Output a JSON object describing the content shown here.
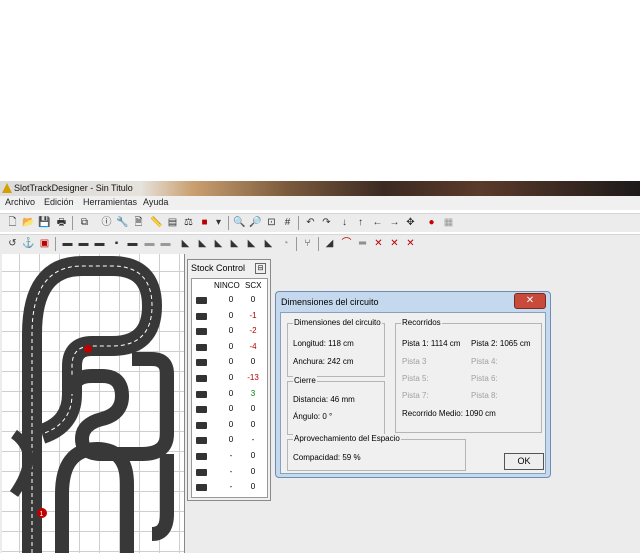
{
  "app": {
    "title": "SlotTrackDesigner - Sin Titulo"
  },
  "menu": [
    "Archivo",
    "Edición",
    "Herramientas",
    "Ayuda"
  ],
  "stock": {
    "title": "Stock Control",
    "close": "⊟",
    "col_ninco": "NINCO",
    "col_scx": "SCX",
    "rows": [
      {
        "icon": "straight-piece-icon",
        "ninco": "0",
        "scx": "0",
        "scx_color": "#000000"
      },
      {
        "icon": "straight-piece-icon",
        "ninco": "0",
        "scx": "-1",
        "scx_color": "#b00000"
      },
      {
        "icon": "short-straight-icon",
        "ninco": "0",
        "scx": "-2",
        "scx_color": "#b00000"
      },
      {
        "icon": "short-straight-icon",
        "ninco": "0",
        "scx": "-4",
        "scx_color": "#b00000"
      },
      {
        "icon": "crossing-piece-icon",
        "ninco": "0",
        "scx": "0",
        "scx_color": "#000000"
      },
      {
        "icon": "curve-piece-icon",
        "ninco": "0",
        "scx": "-13",
        "scx_color": "#b00000"
      },
      {
        "icon": "curve-piece-icon",
        "ninco": "0",
        "scx": "3",
        "scx_color": "#008000"
      },
      {
        "icon": "curve-piece-icon",
        "ninco": "0",
        "scx": "0",
        "scx_color": "#000000"
      },
      {
        "icon": "curve-piece-icon",
        "ninco": "0",
        "scx": "0",
        "scx_color": "#000000"
      },
      {
        "icon": "curve-piece-icon",
        "ninco": "0",
        "scx": "-",
        "scx_color": "#000000"
      },
      {
        "icon": "special-piece-icon",
        "ninco": "-",
        "scx": "0",
        "scx_color": "#000000"
      },
      {
        "icon": "special-piece-icon",
        "ninco": "-",
        "scx": "0",
        "scx_color": "#000000"
      },
      {
        "icon": "special-piece-icon",
        "ninco": "-",
        "scx": "0",
        "scx_color": "#000000"
      }
    ]
  },
  "dialog": {
    "title": "Dimensiones del circuito",
    "close": "✕",
    "dims": {
      "label": "Dimensiones del circuito",
      "longitud": "Longitud: 118 cm",
      "anchura": "Anchura: 242 cm"
    },
    "cierre": {
      "label": "Cierre",
      "distancia": "Distancia: 46 mm",
      "angulo": "Ángulo: 0 °"
    },
    "aprov": {
      "label": "Aprovechamiento del Espacio",
      "compacidad": "Compacidad: 59 %"
    },
    "recorridos": {
      "label": "Recorridos",
      "pista1": "Pista 1: 1114 cm",
      "pista2": "Pista 2: 1065 cm",
      "pista3": "Pista 3",
      "pista4": "Pista 4:",
      "pista5": "Pista 5:",
      "pista6": "Pista 6:",
      "pista7": "Pista 7:",
      "pista8": "Pista 8:",
      "medio": "Recorrido Medio: 1090 cm"
    },
    "ok": "OK"
  },
  "canvas": {
    "marker": "1"
  }
}
